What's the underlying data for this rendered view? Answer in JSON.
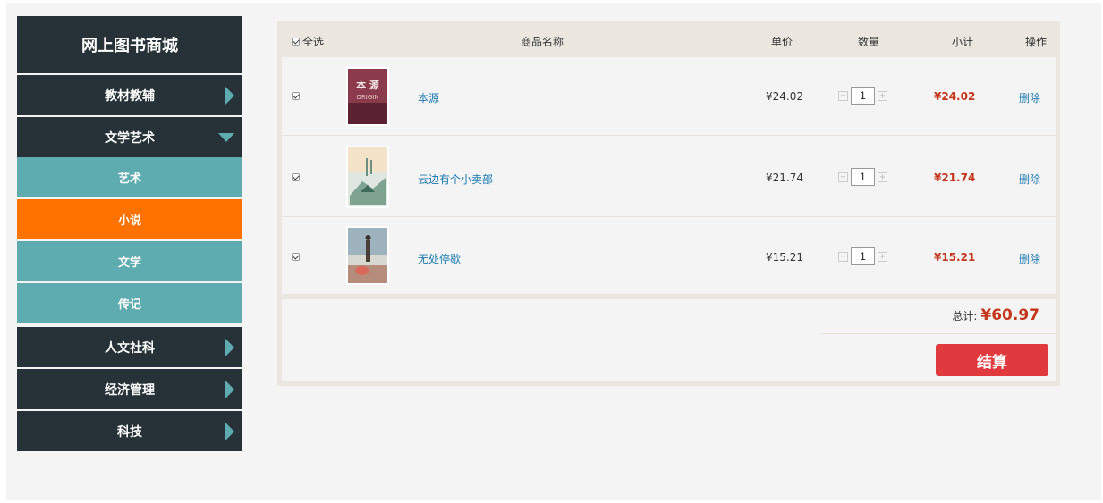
{
  "sidebar": {
    "brand": "网上图书商城",
    "categories": [
      {
        "label": "教材教辅"
      },
      {
        "label": "文学艺术",
        "expanded": true,
        "subs": [
          {
            "label": "艺术"
          },
          {
            "label": "小说",
            "active": true
          },
          {
            "label": "文学"
          },
          {
            "label": "传记"
          }
        ]
      },
      {
        "label": "人文社科"
      },
      {
        "label": "经济管理"
      },
      {
        "label": "科技"
      }
    ]
  },
  "cart": {
    "headers": {
      "select_all": "全选",
      "name": "商品名称",
      "unit_price": "单价",
      "quantity": "数量",
      "subtotal": "小计",
      "action": "操作"
    },
    "items": [
      {
        "checked": true,
        "title": "本源",
        "price": "¥24.02",
        "qty": "1",
        "subtotal": "¥24.02",
        "delete": "删除",
        "cover_text": "本 源",
        "cover_sub": "ORIGIN"
      },
      {
        "checked": true,
        "title": "云边有个小卖部",
        "price": "¥21.74",
        "qty": "1",
        "subtotal": "¥21.74",
        "delete": "删除"
      },
      {
        "checked": true,
        "title": "无处停歇",
        "price": "¥15.21",
        "qty": "1",
        "subtotal": "¥15.21",
        "delete": "删除"
      }
    ],
    "total_label": "总计:",
    "total_value": "¥60.97",
    "checkout": "结算"
  },
  "colors": {
    "sidebar_dark": "#263238",
    "sidebar_teal": "#5facb0",
    "active_orange": "#ff7200",
    "price_red": "#c4351b",
    "link_blue": "#1a7ab0",
    "checkout_red": "#e0393e"
  }
}
